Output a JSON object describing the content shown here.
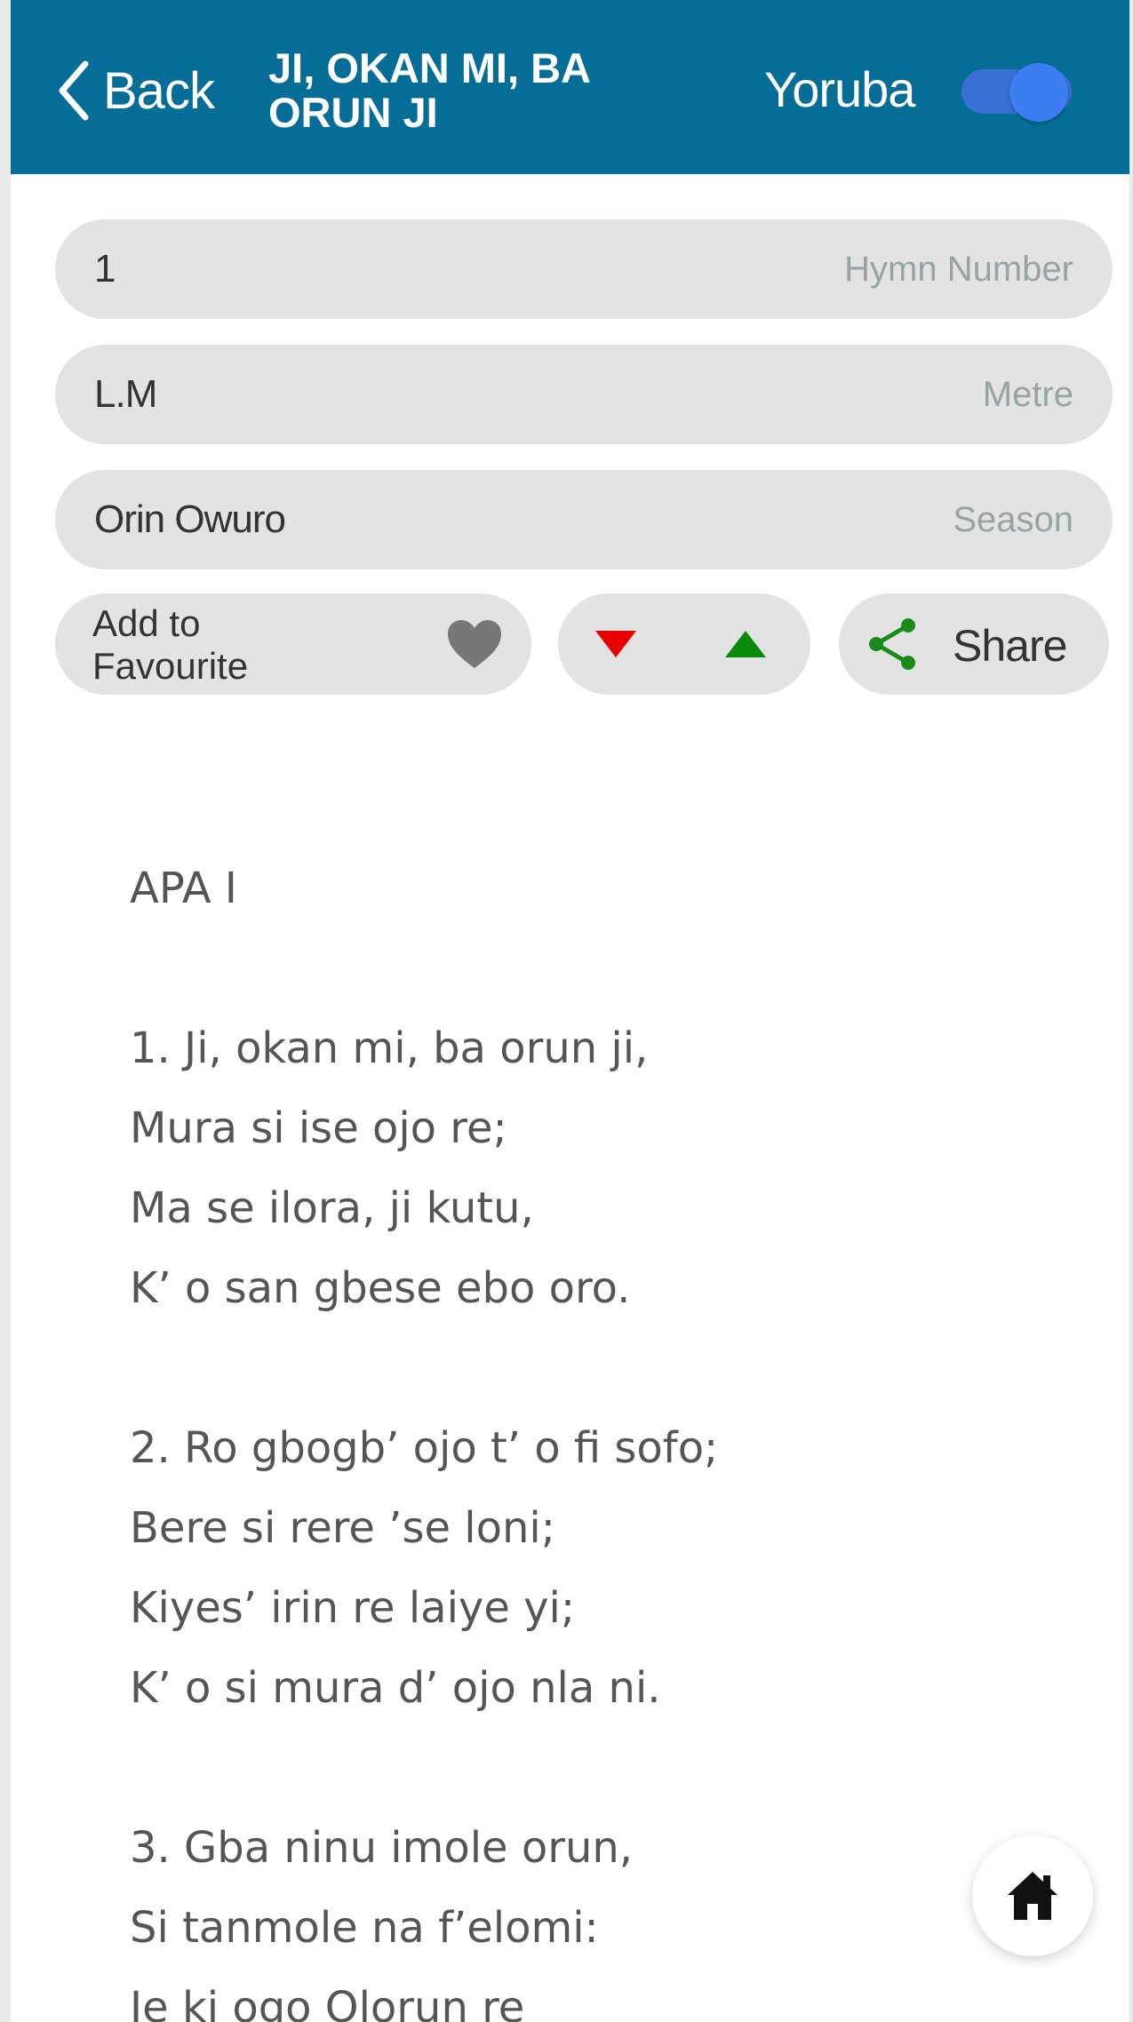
{
  "header": {
    "back_label": "Back",
    "title": "JI, OKAN MI, BA ORUN JI",
    "language_label": "Yoruba",
    "language_toggle_on": true
  },
  "fields": {
    "hymn_number": {
      "value": "1",
      "label": "Hymn Number"
    },
    "metre": {
      "value": "L.M",
      "label": "Metre"
    },
    "season": {
      "value": "Orin Owuro",
      "label": "Season"
    }
  },
  "actions": {
    "favourite_label": "Add to Favourite",
    "share_label": "Share"
  },
  "lyrics": {
    "part": "APA I",
    "verses": [
      [
        "1. Ji, okan mi, ba orun ji,",
        "Mura si ise ojo re;",
        "Ma se ilora, ji kutu,",
        "K’ o san gbese ebo oro."
      ],
      [
        "2. Ro gbogb’ ojo t’ o fi sofo;",
        "Bere si rere ’se loni;",
        "Kiyes’ irin re laiye yi;",
        "K’ o si mura d’ ojo nla ni."
      ],
      [
        "3. Gba ninu imole orun,",
        "Si tanmole na f’elomi:",
        "Je ki ogo Olorun re"
      ]
    ]
  },
  "colors": {
    "header_bg": "#066d97",
    "pill_bg": "#e3e3e3",
    "arrow_down": "#e60000",
    "arrow_up": "#0a8a0a",
    "share_icon": "#1a8a1a",
    "heart": "#777777",
    "toggle": "#3d7ef0"
  },
  "icons": {
    "back": "chevron-left-icon",
    "favourite": "heart-icon",
    "move_down": "triangle-down-icon",
    "move_up": "triangle-up-icon",
    "share": "share-icon",
    "home": "home-icon"
  }
}
